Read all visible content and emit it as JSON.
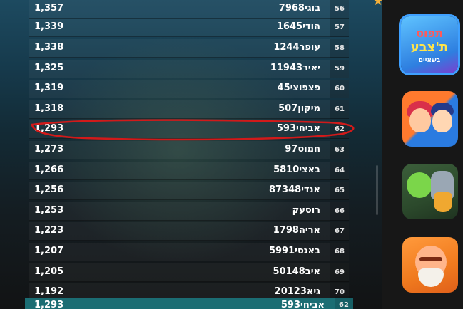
{
  "leaderboard": {
    "rows": [
      {
        "rank": "56",
        "name": "בוגי7968",
        "score": "1,357"
      },
      {
        "rank": "57",
        "name": "הודי1645",
        "score": "1,339"
      },
      {
        "rank": "58",
        "name": "עופר1244",
        "score": "1,338"
      },
      {
        "rank": "59",
        "name": "יאיר11943",
        "score": "1,325"
      },
      {
        "rank": "60",
        "name": "פצפוצי45",
        "score": "1,319"
      },
      {
        "rank": "61",
        "name": "מיקון507",
        "score": "1,318"
      },
      {
        "rank": "62",
        "name": "אביחי593",
        "score": "1,293"
      },
      {
        "rank": "63",
        "name": "חמוס97",
        "score": "1,273"
      },
      {
        "rank": "64",
        "name": "באצי5810",
        "score": "1,266"
      },
      {
        "rank": "65",
        "name": "אנדי87348",
        "score": "1,256"
      },
      {
        "rank": "66",
        "name": "רוסעק",
        "score": "1,253"
      },
      {
        "rank": "67",
        "name": "אריה1798",
        "score": "1,223"
      },
      {
        "rank": "68",
        "name": "באגסי5991",
        "score": "1,207"
      },
      {
        "rank": "69",
        "name": "איב50148",
        "score": "1,205"
      },
      {
        "rank": "70",
        "name": "גיא20123",
        "score": "1,192"
      }
    ],
    "current_player": {
      "rank": "62",
      "name": "אביחי593",
      "score": "1,293"
    }
  },
  "sidebar": {
    "games": [
      {
        "id": "game-1",
        "title_line1": "תפוס",
        "title_line2": "ת'צבע",
        "title_line3": "בשאיים",
        "selected": true
      },
      {
        "id": "game-2",
        "selected": false
      },
      {
        "id": "game-3",
        "selected": false
      },
      {
        "id": "game-4",
        "selected": false
      }
    ]
  },
  "colors": {
    "highlight_row": "#1b6d73",
    "annotation": "#d11a1a",
    "selected_border": "#3fa0ff",
    "star": "#f5b13a"
  },
  "icons": {
    "star": "star-icon"
  }
}
